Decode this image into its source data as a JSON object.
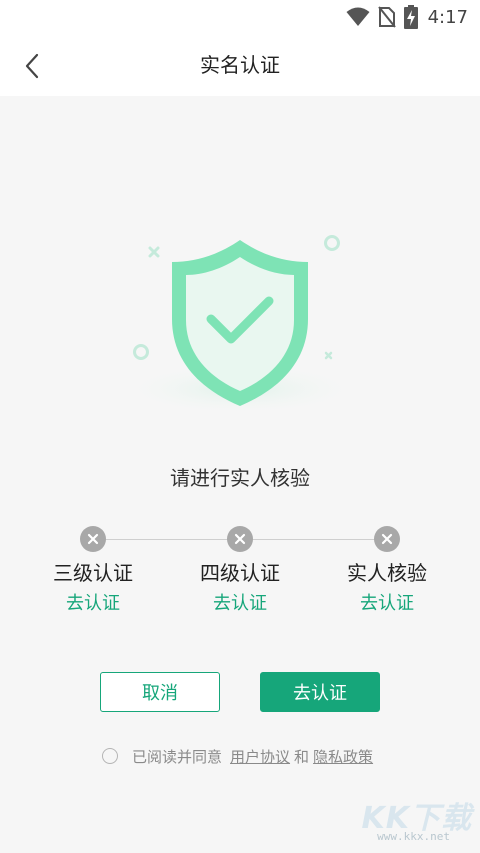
{
  "status_bar": {
    "time": "4:17"
  },
  "header": {
    "title": "实名认证"
  },
  "main": {
    "prompt": "请进行实人核验",
    "steps": [
      {
        "name": "三级认证",
        "action": "去认证"
      },
      {
        "name": "四级认证",
        "action": "去认证"
      },
      {
        "name": "实人核验",
        "action": "去认证"
      }
    ],
    "buttons": {
      "cancel": "取消",
      "go": "去认证"
    }
  },
  "agreement": {
    "prefix": "已阅读并同意",
    "user_agreement": "用户协议",
    "and": "和",
    "privacy_policy": "隐私政策"
  },
  "watermark": {
    "text": "KK下载",
    "url": "www.kkx.net"
  },
  "colors": {
    "accent": "#16a67a",
    "shield": "#7ee3b5",
    "step_dot": "#a8a8a8"
  }
}
